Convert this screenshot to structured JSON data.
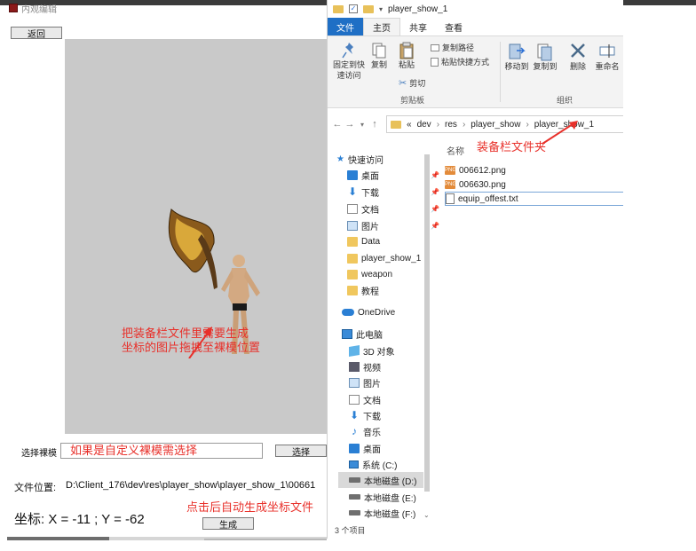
{
  "app": {
    "title": "内观编辑",
    "back_button": "返回",
    "preview_annotation_line1": "把装备栏文件里需要生成",
    "preview_annotation_line2": "坐标的图片拖拽至裸模位置",
    "model_select_label": "选择裸模",
    "model_input_value": "如果是自定义裸模需选择",
    "select_button": "选择",
    "file_location_label": "文件位置:",
    "file_location_value": "D:\\Client_176\\dev\\res\\player_show\\player_show_1\\00661",
    "coord_text": "坐标:  X = -11 ;   Y = -62",
    "generate_annotation": "点击后自动生成坐标文件",
    "generate_button": "生成"
  },
  "explorer": {
    "title": "player_show_1",
    "tabs": [
      "文件",
      "主页",
      "共享",
      "查看"
    ],
    "active_tab": "主页",
    "ribbon": {
      "pin_quick_access_line1": "固定到快",
      "pin_quick_access_line2": "速访问",
      "copy": "复制",
      "paste": "粘贴",
      "copy_path": "复制路径",
      "paste_shortcut": "粘贴快捷方式",
      "cut": "剪切",
      "clipboard_group": "剪贴板",
      "move_to": "移动到",
      "copy_to": "复制到",
      "delete": "删除",
      "rename": "重命名",
      "organize_group": "组织"
    },
    "breadcrumb": [
      "«",
      "dev",
      "res",
      "player_show",
      "player_show_1"
    ],
    "nav": {
      "quick_access": "快速访问",
      "items": [
        "桌面",
        "下载",
        "文档",
        "图片",
        "Data",
        "player_show_1",
        "weapon",
        "教程"
      ],
      "onedrive": "OneDrive",
      "this_pc": "此电脑",
      "pc_items": [
        "3D 对象",
        "视频",
        "图片",
        "文档",
        "下载",
        "音乐",
        "桌面",
        "系统 (C:)",
        "本地磁盘 (D:)",
        "本地磁盘 (E:)",
        "本地磁盘 (F:)"
      ]
    },
    "column_name": "名称",
    "files_annotation": "装备栏文件夹",
    "files": [
      "006612.png",
      "006630.png",
      "equip_offest.txt"
    ],
    "status": "3 个项目"
  },
  "colors": {
    "annotation_red": "#e8302a",
    "file_tab_blue": "#1f6fc5",
    "preview_gray": "#c9c9c9"
  }
}
